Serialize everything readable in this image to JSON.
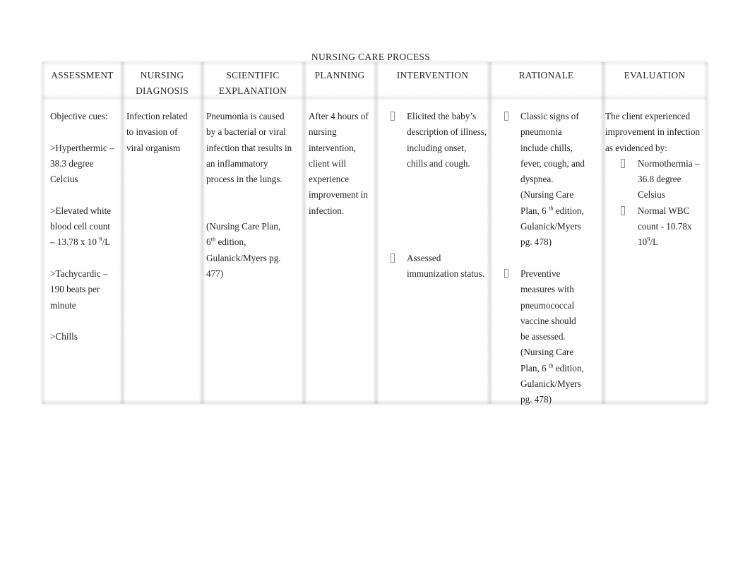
{
  "document": {
    "title": "NURSING CARE PROCESS"
  },
  "table": {
    "headers": [
      "ASSESSMENT",
      "NURSING DIAGNOSIS",
      "SCIENTIFIC EXPLANATION",
      "PLANNING",
      "INTERVENTION",
      "RATIONALE",
      "EVALUATION"
    ],
    "assessment": {
      "intro": "Objective cues:",
      "cue_1_line_1": ">Hyperthermic –",
      "cue_1_line_2": "38.3 degree",
      "cue_1_line_3": "Celcius",
      "cue_2_line_1": ">Elevated white",
      "cue_2_line_2": "blood cell count",
      "cue_2_line_3_pre": "– 13.78 x 10 ",
      "cue_2_line_3_sup": "9",
      "cue_2_line_3_post": "/L",
      "cue_3_line_1": ">Tachycardic –",
      "cue_3_line_2": "190 beats per",
      "cue_3_line_3": "minute",
      "cue_4": ">Chills"
    },
    "nursing_diagnosis": {
      "line_1": "Infection related",
      "line_2": "to invasion of",
      "line_3": "viral organism"
    },
    "scientific_explanation": {
      "line_1": "Pneumonia is caused",
      "line_2": "by a bacterial or viral",
      "line_3": "infection that results in",
      "line_4": "an inflammatory",
      "line_5": "process in the lungs.",
      "source_line_1": "(Nursing Care Plan,",
      "source_line_2_pre": "6",
      "source_line_2_sup": "th",
      "source_line_2_post": " edition,",
      "source_line_3": "Gulanick/Myers pg.",
      "source_line_4": "477)"
    },
    "planning": {
      "line_1": "After 4 hours of",
      "line_2": "nursing",
      "line_3": "intervention,",
      "line_4": "client will",
      "line_5": "experience",
      "line_6": "improvement in",
      "line_7": "infection."
    },
    "intervention": {
      "items": [
        {
          "line_1": "Elicited the baby’s",
          "line_2": "description of illness,",
          "line_3": "including onset,",
          "line_4": "chills and cough."
        },
        {
          "line_1": "Assessed",
          "line_2": "immunization status."
        }
      ]
    },
    "rationale": {
      "items": [
        {
          "line_1": "Classic signs of",
          "line_2": "pneumonia",
          "line_3": "include chills,",
          "line_4": "fever, cough, and",
          "line_5": "dyspnea.",
          "source_line_1": "(Nursing Care",
          "source_line_2_pre": "Plan, 6 ",
          "source_line_2_sup": "th",
          "source_line_2_post": " edition,",
          "source_line_3": "Gulanick/Myers",
          "source_line_4": "pg. 478)"
        },
        {
          "line_1": "Preventive",
          "line_2": "measures with",
          "line_3": "pneumococcal",
          "line_4": "vaccine should",
          "line_5": "be assessed.",
          "source_line_1": "(Nursing Care",
          "source_line_2_pre": "Plan, 6 ",
          "source_line_2_sup": "th",
          "source_line_2_post": " edition,",
          "source_line_3": "Gulanick/Myers",
          "source_line_4": "pg. 478)"
        }
      ]
    },
    "evaluation": {
      "intro_line_1": "The client experienced",
      "intro_line_2": "improvement in infection",
      "intro_line_3": "as evidenced by:",
      "items": [
        {
          "line_1": "Normothermia –",
          "line_2": "36.8 degree",
          "line_3": "Celsius"
        },
        {
          "line_1": "Normal WBC",
          "line_2": "count - 10.78x",
          "line_3_pre": "10",
          "line_3_sup": "9",
          "line_3_post": "/L"
        }
      ]
    }
  }
}
